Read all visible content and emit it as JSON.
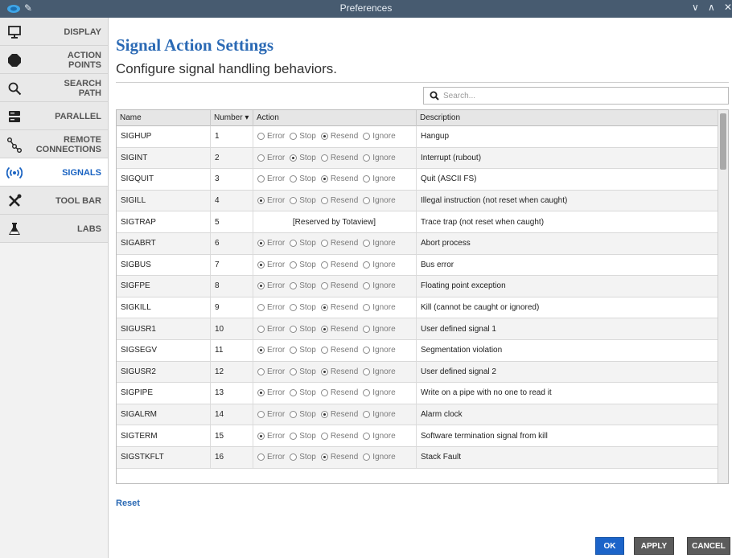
{
  "window": {
    "title": "Preferences"
  },
  "sidebar": {
    "items": [
      {
        "label": "DISPLAY",
        "icon": "monitor-icon",
        "active": false
      },
      {
        "label": "ACTION\nPOINTS",
        "icon": "stop-octagon-icon",
        "active": false
      },
      {
        "label": "SEARCH\nPATH",
        "icon": "search-icon",
        "active": false
      },
      {
        "label": "PARALLEL",
        "icon": "server-icon",
        "active": false
      },
      {
        "label": "REMOTE\nCONNECTIONS",
        "icon": "network-icon",
        "active": false
      },
      {
        "label": "SIGNALS",
        "icon": "broadcast-icon",
        "active": true
      },
      {
        "label": "TOOL BAR",
        "icon": "tools-icon",
        "active": false
      },
      {
        "label": "LABS",
        "icon": "flask-icon",
        "active": false
      }
    ]
  },
  "page": {
    "title": "Signal Action Settings",
    "subtitle": "Configure signal handling behaviors."
  },
  "search": {
    "placeholder": "Search..."
  },
  "table": {
    "columns": [
      "Name",
      "Number ▾",
      "Action",
      "Description"
    ],
    "action_options": [
      "Error",
      "Stop",
      "Resend",
      "Ignore"
    ],
    "rows": [
      {
        "name": "SIGHUP",
        "number": "1",
        "action": "Resend",
        "description": "Hangup"
      },
      {
        "name": "SIGINT",
        "number": "2",
        "action": "Stop",
        "description": "Interrupt (rubout)"
      },
      {
        "name": "SIGQUIT",
        "number": "3",
        "action": "Resend",
        "description": "Quit (ASCII FS)"
      },
      {
        "name": "SIGILL",
        "number": "4",
        "action": "Error",
        "description": "Illegal instruction (not reset when caught)"
      },
      {
        "name": "SIGTRAP",
        "number": "5",
        "action": "",
        "reserved": "[Reserved by Totaview]",
        "description": "Trace trap (not reset when caught)"
      },
      {
        "name": "SIGABRT",
        "number": "6",
        "action": "Error",
        "description": "Abort process"
      },
      {
        "name": "SIGBUS",
        "number": "7",
        "action": "Error",
        "description": "Bus error"
      },
      {
        "name": "SIGFPE",
        "number": "8",
        "action": "Error",
        "description": "Floating point exception"
      },
      {
        "name": "SIGKILL",
        "number": "9",
        "action": "Resend",
        "description": "Kill (cannot be caught or ignored)"
      },
      {
        "name": "SIGUSR1",
        "number": "10",
        "action": "Resend",
        "description": "User defined signal 1"
      },
      {
        "name": "SIGSEGV",
        "number": "11",
        "action": "Error",
        "description": "Segmentation violation"
      },
      {
        "name": "SIGUSR2",
        "number": "12",
        "action": "Resend",
        "description": "User defined signal 2"
      },
      {
        "name": "SIGPIPE",
        "number": "13",
        "action": "Error",
        "description": "Write on a pipe with no one to read it"
      },
      {
        "name": "SIGALRM",
        "number": "14",
        "action": "Resend",
        "description": "Alarm clock"
      },
      {
        "name": "SIGTERM",
        "number": "15",
        "action": "Error",
        "description": "Software termination signal from kill"
      },
      {
        "name": "SIGSTKFLT",
        "number": "16",
        "action": "Resend",
        "description": "Stack Fault"
      }
    ]
  },
  "footer": {
    "reset_label": "Reset",
    "ok_label": "OK",
    "apply_label": "APPLY",
    "cancel_label": "CANCEL"
  },
  "colors": {
    "titlebar": "#475b70",
    "accent": "#2a69b4",
    "active_nav": "#1a63c2",
    "primary_button": "#1c64c9",
    "secondary_button": "#5b5b5b"
  }
}
